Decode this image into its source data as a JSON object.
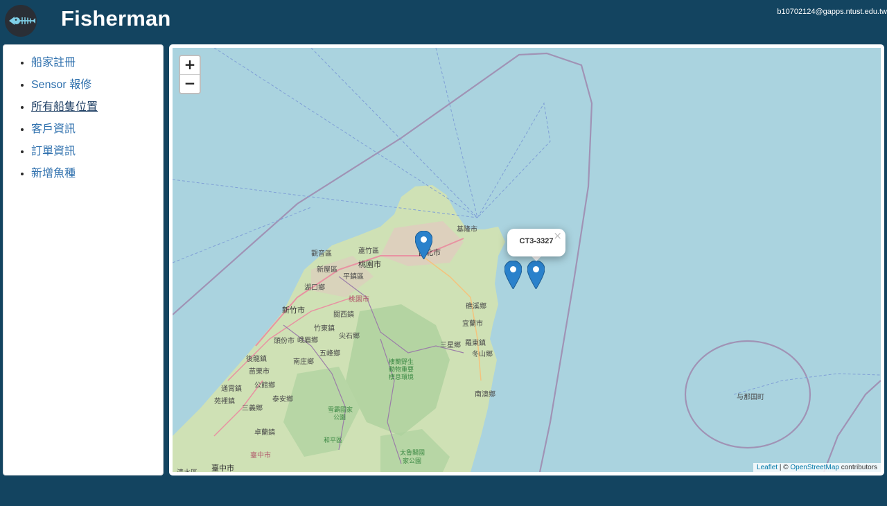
{
  "header": {
    "title": "Fisherman",
    "user_email": "b10702124@gapps.ntust.edu.tw",
    "logo_icon": "fish-skeleton-icon"
  },
  "sidebar": {
    "items": [
      {
        "label": "船家註冊",
        "active": false
      },
      {
        "label": "Sensor 報修",
        "active": false
      },
      {
        "label": "所有船隻位置",
        "active": true
      },
      {
        "label": "客戶資訊",
        "active": false
      },
      {
        "label": "訂單資訊",
        "active": false
      },
      {
        "label": "新增魚種",
        "active": false
      }
    ]
  },
  "map": {
    "zoom_in_label": "+",
    "zoom_out_label": "−",
    "popup": {
      "text": "CT3-3327",
      "close": "×"
    },
    "attribution": {
      "leaflet": "Leaflet",
      "separator": " | © ",
      "osm": "OpenStreetMap",
      "suffix": " contributors"
    },
    "labels": {
      "keelung": "基隆市",
      "taipei": "台北市",
      "guanyin": "觀音區",
      "luzhu": "蘆竹區",
      "taoyuan": "桃園市",
      "xinwu": "新屋區",
      "pingzhen": "平鎮區",
      "hukou": "湖口鄉",
      "taoyuan2": "桃園市",
      "hsinchu": "新竹市",
      "guanxi": "關西鎮",
      "zhudong": "竹東鎮",
      "jianshi": "尖石鄉",
      "toufen": "頭份市",
      "emei": "峨眉鄉",
      "houlong": "後龍鎮",
      "miaoli": "苗栗市",
      "nanzhuang": "南庄鄉",
      "wufeng": "五峰鄉",
      "tongxiao": "通霄鎮",
      "gongguan": "公館鄉",
      "yuanli": "苑裡鎮",
      "sanyi": "三義鄉",
      "taian": "泰安鄉",
      "zhuolan": "卓蘭鎮",
      "taichung": "臺中市",
      "taichung2": "臺中市",
      "qingshui": "清水區",
      "toucheng": "礁溪鄉",
      "yilan": "宜蘭市",
      "sanxing": "三星鄉",
      "luodong": "羅東鎮",
      "dongshan": "冬山鄉",
      "nanao": "南澳鄉",
      "wildlife": "棲蘭野生",
      "wildlife2": "動物重要",
      "wildlife3": "棲息環境",
      "shei_pa": "雪霸國家",
      "shei_pa2": "公園",
      "taroko": "太魯閣國",
      "taroko2": "家公園",
      "heping": "和平區",
      "yonaguni": "与那国町"
    }
  },
  "colors": {
    "background": "#134460",
    "sea": "#aad3df",
    "land": "#cfe1b5",
    "link": "#2d6fad",
    "marker": "#2a81cb"
  }
}
